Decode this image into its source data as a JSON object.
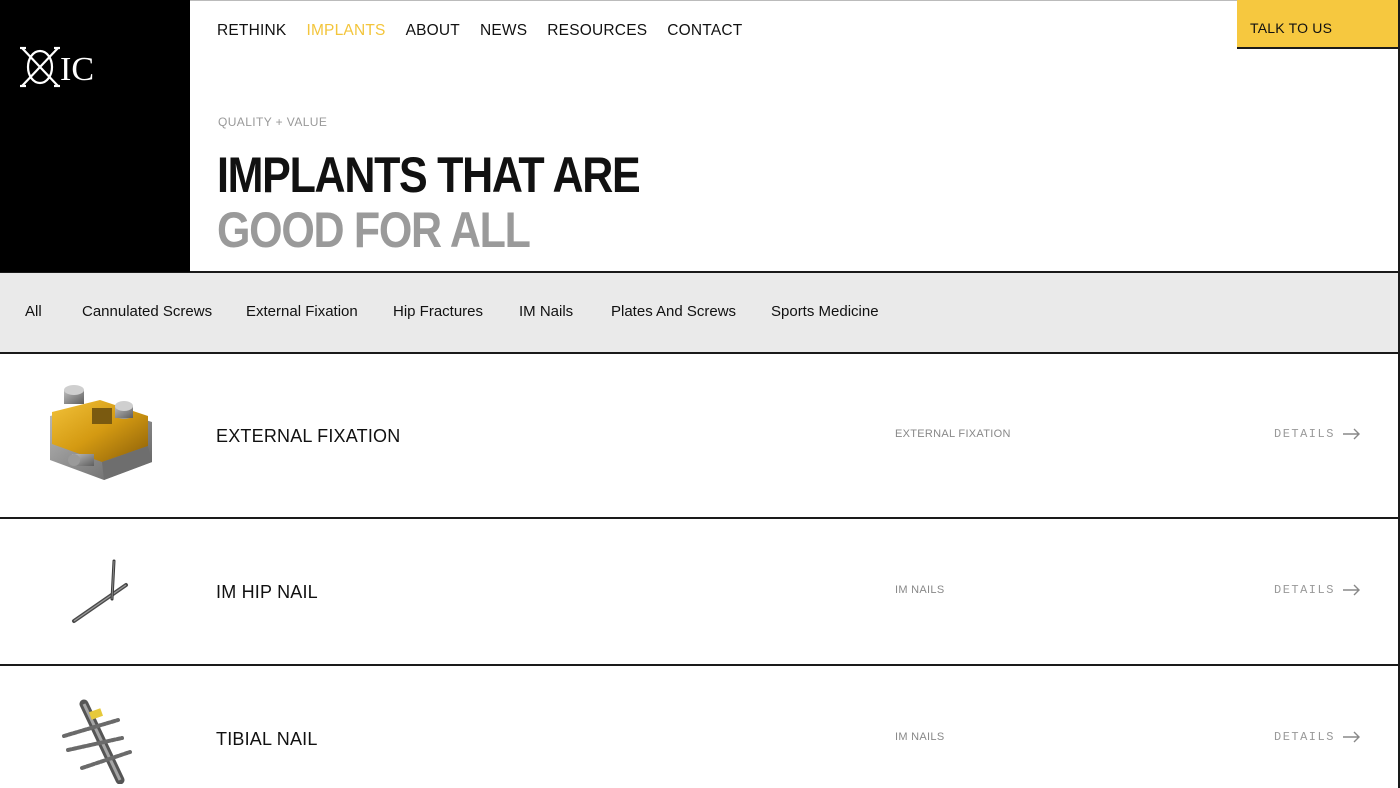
{
  "brand": {
    "logo_text": "OIC"
  },
  "nav": {
    "items": [
      {
        "label": "RETHINK",
        "active": false
      },
      {
        "label": "IMPLANTS",
        "active": true
      },
      {
        "label": "ABOUT",
        "active": false
      },
      {
        "label": "NEWS",
        "active": false
      },
      {
        "label": "RESOURCES",
        "active": false
      },
      {
        "label": "CONTACT",
        "active": false
      }
    ],
    "cta_label": "TALK TO US"
  },
  "hero": {
    "eyebrow": "QUALITY + VALUE",
    "title_line1": "IMPLANTS THAT ARE",
    "title_line2": "GOOD FOR ALL"
  },
  "filters": [
    "All",
    "Cannulated Screws",
    "External Fixation",
    "Hip Fractures",
    "IM Nails",
    "Plates And Screws",
    "Sports Medicine"
  ],
  "products": [
    {
      "name": "EXTERNAL FIXATION",
      "category": "EXTERNAL FIXATION",
      "details_label": "DETAILS"
    },
    {
      "name": "IM HIP NAIL",
      "category": "IM NAILS",
      "details_label": "DETAILS"
    },
    {
      "name": "TIBIAL NAIL",
      "category": "IM NAILS",
      "details_label": "DETAILS"
    }
  ],
  "colors": {
    "accent": "#f6c83f",
    "active_nav": "#f3c53c",
    "muted": "#9a9a9a",
    "filter_bg": "#eaeaea"
  }
}
